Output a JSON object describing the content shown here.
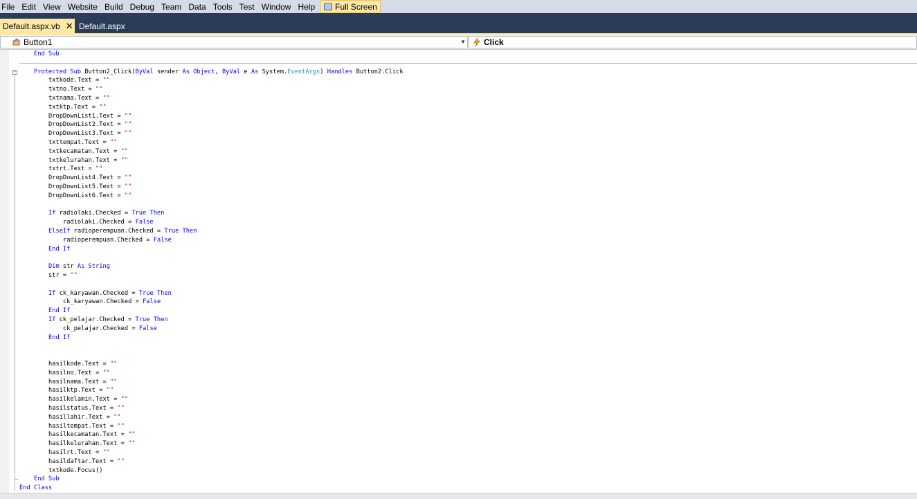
{
  "menu": {
    "items": [
      "File",
      "Edit",
      "View",
      "Website",
      "Build",
      "Debug",
      "Team",
      "Data",
      "Tools",
      "Test",
      "Window",
      "Help"
    ],
    "fullscreen_label": "Full Screen"
  },
  "tabs": [
    {
      "label": "Default.aspx.vb",
      "active": true,
      "close": "✕"
    },
    {
      "label": "Default.aspx",
      "active": false
    }
  ],
  "navbar": {
    "class_combo": "Button1",
    "method_combo": "Click"
  },
  "code": [
    {
      "indent": 2,
      "tokens": [
        {
          "t": "End Sub",
          "c": "kw"
        }
      ]
    },
    {
      "sep": true
    },
    {
      "indent": 2,
      "tokens": [
        {
          "t": "Protected Sub",
          "c": "kw"
        },
        {
          "t": " Button2_Click("
        },
        {
          "t": "ByVal",
          "c": "kw"
        },
        {
          "t": " sender "
        },
        {
          "t": "As Object",
          "c": "kw"
        },
        {
          "t": ", "
        },
        {
          "t": "ByVal",
          "c": "kw"
        },
        {
          "t": " e "
        },
        {
          "t": "As",
          "c": "kw"
        },
        {
          "t": " System."
        },
        {
          "t": "EventArgs",
          "c": "typ"
        },
        {
          "t": ") "
        },
        {
          "t": "Handles",
          "c": "kw"
        },
        {
          "t": " Button2.Click"
        }
      ]
    },
    {
      "indent": 3,
      "tokens": [
        {
          "t": "txtkode.Text = "
        },
        {
          "t": "\"\"",
          "c": "str"
        }
      ]
    },
    {
      "indent": 3,
      "tokens": [
        {
          "t": "txtno.Text = "
        },
        {
          "t": "\"\"",
          "c": "str"
        }
      ]
    },
    {
      "indent": 3,
      "tokens": [
        {
          "t": "txtnama.Text = "
        },
        {
          "t": "\"\"",
          "c": "str"
        }
      ]
    },
    {
      "indent": 3,
      "tokens": [
        {
          "t": "txtktp.Text = "
        },
        {
          "t": "\"\"",
          "c": "str"
        }
      ]
    },
    {
      "indent": 3,
      "tokens": [
        {
          "t": "DropDownList1.Text = "
        },
        {
          "t": "\"\"",
          "c": "str"
        }
      ]
    },
    {
      "indent": 3,
      "tokens": [
        {
          "t": "DropDownList2.Text = "
        },
        {
          "t": "\"\"",
          "c": "str"
        }
      ]
    },
    {
      "indent": 3,
      "tokens": [
        {
          "t": "DropDownList3.Text = "
        },
        {
          "t": "\"\"",
          "c": "str"
        }
      ]
    },
    {
      "indent": 3,
      "tokens": [
        {
          "t": "txttempat.Text = "
        },
        {
          "t": "\"\"",
          "c": "str"
        }
      ]
    },
    {
      "indent": 3,
      "tokens": [
        {
          "t": "txtkecamatan.Text = "
        },
        {
          "t": "\"\"",
          "c": "str"
        }
      ]
    },
    {
      "indent": 3,
      "tokens": [
        {
          "t": "txtkelurahan.Text = "
        },
        {
          "t": "\"\"",
          "c": "str"
        }
      ]
    },
    {
      "indent": 3,
      "tokens": [
        {
          "t": "txtrt.Text = "
        },
        {
          "t": "\"\"",
          "c": "str"
        }
      ]
    },
    {
      "indent": 3,
      "tokens": [
        {
          "t": "DropDownList4.Text = "
        },
        {
          "t": "\"\"",
          "c": "str"
        }
      ]
    },
    {
      "indent": 3,
      "tokens": [
        {
          "t": "DropDownList5.Text = "
        },
        {
          "t": "\"\"",
          "c": "str"
        }
      ]
    },
    {
      "indent": 3,
      "tokens": [
        {
          "t": "DropDownList6.Text = "
        },
        {
          "t": "\"\"",
          "c": "str"
        }
      ]
    },
    {
      "indent": 3,
      "tokens": []
    },
    {
      "indent": 3,
      "tokens": [
        {
          "t": "If",
          "c": "kw"
        },
        {
          "t": " radiolaki.Checked = "
        },
        {
          "t": "True Then",
          "c": "kw"
        }
      ]
    },
    {
      "indent": 4,
      "tokens": [
        {
          "t": "radiolaki.Checked = "
        },
        {
          "t": "False",
          "c": "kw"
        }
      ]
    },
    {
      "indent": 3,
      "tokens": [
        {
          "t": "ElseIf",
          "c": "kw"
        },
        {
          "t": " radioperempuan.Checked = "
        },
        {
          "t": "True Then",
          "c": "kw"
        }
      ]
    },
    {
      "indent": 4,
      "tokens": [
        {
          "t": "radioperempuan.Checked = "
        },
        {
          "t": "False",
          "c": "kw"
        }
      ]
    },
    {
      "indent": 3,
      "tokens": [
        {
          "t": "End If",
          "c": "kw"
        }
      ]
    },
    {
      "indent": 3,
      "tokens": []
    },
    {
      "indent": 3,
      "tokens": [
        {
          "t": "Dim",
          "c": "kw"
        },
        {
          "t": " str "
        },
        {
          "t": "As String",
          "c": "kw"
        }
      ]
    },
    {
      "indent": 3,
      "tokens": [
        {
          "t": "str = "
        },
        {
          "t": "\"\"",
          "c": "str"
        }
      ]
    },
    {
      "indent": 3,
      "tokens": []
    },
    {
      "indent": 3,
      "tokens": [
        {
          "t": "If",
          "c": "kw"
        },
        {
          "t": " ck_karyawan.Checked = "
        },
        {
          "t": "True Then",
          "c": "kw"
        }
      ]
    },
    {
      "indent": 4,
      "tokens": [
        {
          "t": "ck_karyawan.Checked = "
        },
        {
          "t": "False",
          "c": "kw"
        }
      ]
    },
    {
      "indent": 3,
      "tokens": [
        {
          "t": "End If",
          "c": "kw"
        }
      ]
    },
    {
      "indent": 3,
      "tokens": [
        {
          "t": "If",
          "c": "kw"
        },
        {
          "t": " ck_pelajar.Checked = "
        },
        {
          "t": "True Then",
          "c": "kw"
        }
      ]
    },
    {
      "indent": 4,
      "tokens": [
        {
          "t": "ck_pelajar.Checked = "
        },
        {
          "t": "False",
          "c": "kw"
        }
      ]
    },
    {
      "indent": 3,
      "tokens": [
        {
          "t": "End If",
          "c": "kw"
        }
      ]
    },
    {
      "indent": 3,
      "tokens": []
    },
    {
      "indent": 3,
      "tokens": []
    },
    {
      "indent": 3,
      "tokens": [
        {
          "t": "hasilkode.Text = "
        },
        {
          "t": "\"\"",
          "c": "str"
        }
      ]
    },
    {
      "indent": 3,
      "tokens": [
        {
          "t": "hasilno.Text = "
        },
        {
          "t": "\"\"",
          "c": "str"
        }
      ]
    },
    {
      "indent": 3,
      "tokens": [
        {
          "t": "hasilnama.Text = "
        },
        {
          "t": "\"\"",
          "c": "str"
        }
      ]
    },
    {
      "indent": 3,
      "tokens": [
        {
          "t": "hasilktp.Text = "
        },
        {
          "t": "\"\"",
          "c": "str"
        }
      ]
    },
    {
      "indent": 3,
      "tokens": [
        {
          "t": "hasilkelamin.Text = "
        },
        {
          "t": "\"\"",
          "c": "str"
        }
      ]
    },
    {
      "indent": 3,
      "tokens": [
        {
          "t": "hasilstatus.Text = "
        },
        {
          "t": "\"\"",
          "c": "str"
        }
      ]
    },
    {
      "indent": 3,
      "tokens": [
        {
          "t": "hasillahir.Text = "
        },
        {
          "t": "\"\"",
          "c": "str"
        }
      ]
    },
    {
      "indent": 3,
      "tokens": [
        {
          "t": "hasiltempat.Text = "
        },
        {
          "t": "\"\"",
          "c": "str"
        }
      ]
    },
    {
      "indent": 3,
      "tokens": [
        {
          "t": "hasilkecamatan.Text = "
        },
        {
          "t": "\"\"",
          "c": "str"
        }
      ]
    },
    {
      "indent": 3,
      "tokens": [
        {
          "t": "hasilkelurahan.Text = "
        },
        {
          "t": "\"\"",
          "c": "str"
        }
      ]
    },
    {
      "indent": 3,
      "tokens": [
        {
          "t": "hasilrt.Text = "
        },
        {
          "t": "\"\"",
          "c": "str"
        }
      ]
    },
    {
      "indent": 3,
      "tokens": [
        {
          "t": "hasildaftar.Text = "
        },
        {
          "t": "\"\"",
          "c": "str"
        }
      ]
    },
    {
      "indent": 3,
      "tokens": [
        {
          "t": "txtkode.Focus()"
        }
      ]
    },
    {
      "indent": 2,
      "tokens": [
        {
          "t": "End Sub",
          "c": "kw"
        }
      ]
    },
    {
      "indent": 1,
      "tokens": [
        {
          "t": "End Class",
          "c": "kw"
        }
      ]
    }
  ]
}
